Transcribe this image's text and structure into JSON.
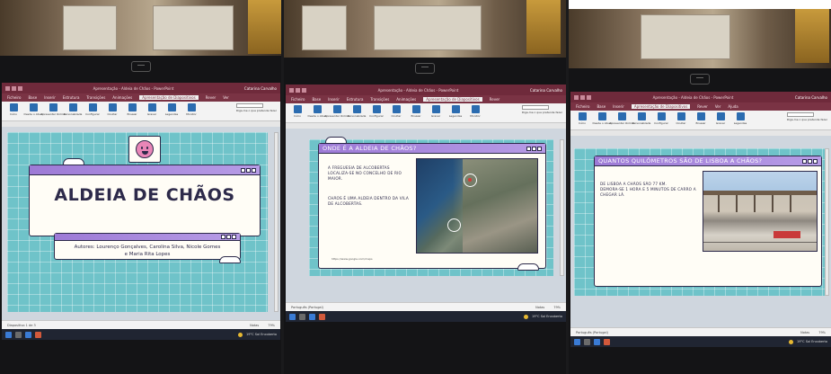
{
  "app": {
    "doc_title": "Apresentação - Aldeia de Chãos - PowerPoint",
    "user": "Catarina Carvalho",
    "tabs": [
      "Ficheiro",
      "Base",
      "Inserir",
      "Estrutura",
      "Transições",
      "Animações",
      "Apresentação de Diapositivos",
      "Rever",
      "Ver",
      "Ajuda"
    ],
    "active_tab": "Apresentação de Diapositivos",
    "ribbon_buttons": [
      "Início",
      "Desde o Atual",
      "Apresentar Online",
      "Personalizada",
      "Configurar",
      "Ocultar",
      "Ensaiar",
      "Gravar",
      "Legendas",
      "Monitor"
    ],
    "search_label": "Diga-me o que pretende fazer",
    "status": {
      "slide": "Diapositivo 1 de 3",
      "language": "Português (Portugal)",
      "notes": "Notas",
      "zoom": "79%"
    },
    "weather": "19°C  Sol  Encoberto",
    "colors": {
      "title_bar": "#6f2a3b",
      "window_header": "#9d7ad6",
      "slide_bg": "#6fc3c9",
      "ink": "#2d2a4a",
      "face": "#e886b7"
    }
  },
  "slides": [
    {
      "title": "ALDEIA DE CHÃOS",
      "authors_line1": "Autores: Lourenço Gonçalves, Carolina Silva, Nicole Gomes",
      "authors_line2": "e Maria Rita Lopes",
      "icon": "smiley-face-icon"
    },
    {
      "title": "ONDE É A ALDEIA DE CHÃOS?",
      "text1": "A FREGUESIA DE ALCOBERTAS LOCALIZA-SE NO CONCELHO DE RIO MAIOR.",
      "text2": "CHÃOS É UMA ALDEIA DENTRO DA VILA DE ALCOBERTAS.",
      "source": "https://www.google.com/maps",
      "image": "satellite-map"
    },
    {
      "title": "QUANTOS QUILÓMETROS SÃO DE LISBOA A CHÃOS?",
      "text1": "DE LISBOA A CHÃOS SÃO 77 KM.",
      "text2": "DEMORA-SE 1 HORA E 5 MINUTOS DE CARRO A CHEGAR LÁ.",
      "image": "lisbon-station-photo"
    }
  ]
}
